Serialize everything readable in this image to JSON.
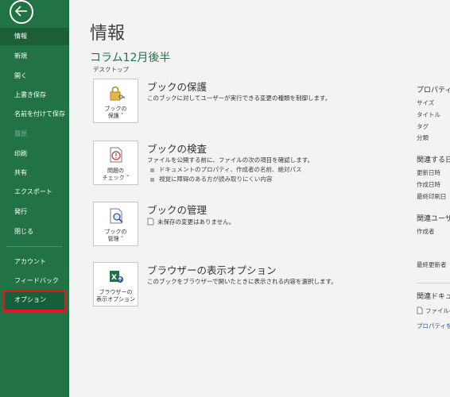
{
  "sidebar": {
    "items": [
      {
        "label": "情報",
        "state": "active"
      },
      {
        "label": "新規"
      },
      {
        "label": "開く"
      },
      {
        "label": "上書き保存"
      },
      {
        "label": "名前を付けて保存"
      },
      {
        "label": "履歴",
        "state": "disabled"
      },
      {
        "label": "印刷"
      },
      {
        "label": "共有"
      },
      {
        "label": "エクスポート"
      },
      {
        "label": "発行"
      },
      {
        "label": "閉じる"
      },
      {
        "label": "アカウント"
      },
      {
        "label": "フィードバック"
      },
      {
        "label": "オプション",
        "state": "highlighted"
      }
    ],
    "highlight_color": "#e8141c",
    "bg_color": "#217346"
  },
  "main": {
    "title": "情報",
    "doc_name": "コラム12月後半",
    "doc_location": "デスクトップ",
    "sections": [
      {
        "button": [
          "ブックの",
          "保護 ˅"
        ],
        "icon": "lock-key-icon",
        "title": "ブックの保護",
        "desc": "このブックに対してユーザーが実行できる変更の種類を制御します。"
      },
      {
        "button": [
          "問題の",
          "チェック ˅"
        ],
        "icon": "inspect-document-icon",
        "title": "ブックの検査",
        "desc": "ファイルを公開する前に、ファイルの次の項目を確認します。",
        "bullets": [
          "ドキュメントのプロパティ、作成者の名前、絶対パス",
          "視覚に障碍のある方が読み取りにくい内容"
        ]
      },
      {
        "button": [
          "ブックの",
          "管理 ˅"
        ],
        "icon": "manage-workbook-icon",
        "title": "ブックの管理",
        "desc": "未保存の変更はありません。"
      },
      {
        "button": [
          "ブラウザーの",
          "表示オプション"
        ],
        "icon": "browser-view-icon",
        "title": "ブラウザーの表示オプション",
        "desc": "このブックをブラウザーで開いたときに表示される内容を選択します。"
      }
    ]
  },
  "properties": {
    "header": "プロパティ ˅",
    "rows": [
      "サイズ",
      "タイトル",
      "タグ",
      "分類"
    ],
    "related_dates_header": "関連する日",
    "date_rows": [
      "更新日時",
      "作成日時",
      "最終印刷日"
    ],
    "related_people_header": "関連ユーザ",
    "people_rows": [
      "作成者",
      "最終更新者"
    ],
    "related_docs_header": "関連ドキュ",
    "doc_rows": [
      "ファイルの"
    ],
    "link": "プロパティをす"
  }
}
